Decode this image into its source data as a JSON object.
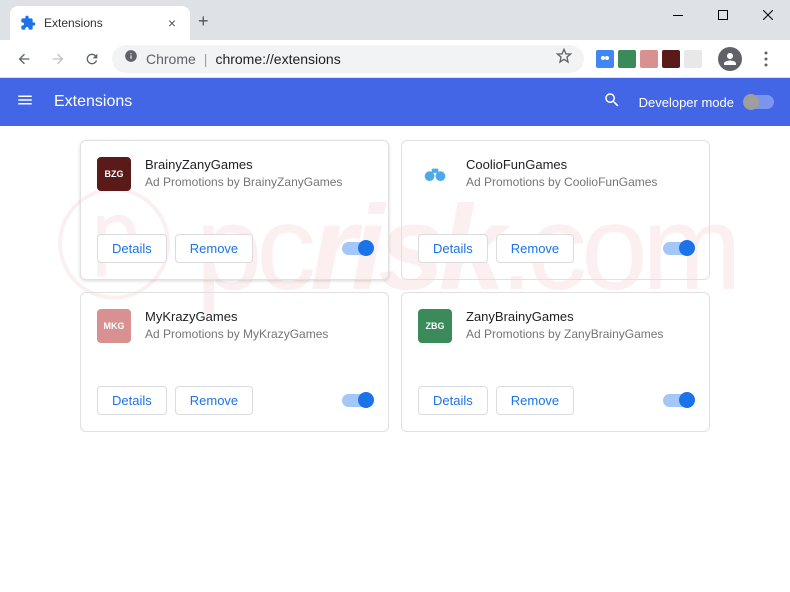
{
  "window": {
    "tab_title": "Extensions"
  },
  "address": {
    "prefix": "Chrome",
    "url": "chrome://extensions"
  },
  "header": {
    "title": "Extensions",
    "developer_mode": "Developer mode"
  },
  "buttons": {
    "details": "Details",
    "remove": "Remove"
  },
  "extensions": [
    {
      "name": "BrainyZanyGames",
      "description": "Ad Promotions by BrainyZanyGames",
      "logo_text": "BZG",
      "logo_bg": "#5a1a1a",
      "selected": true
    },
    {
      "name": "CoolioFunGames",
      "description": "Ad Promotions by CoolioFunGames",
      "logo_text": "",
      "logo_bg": "#ffffff",
      "icon": "binoculars",
      "selected": false
    },
    {
      "name": "MyKrazyGames",
      "description": "Ad Promotions by MyKrazyGames",
      "logo_text": "MKG",
      "logo_bg": "#d89090",
      "selected": false
    },
    {
      "name": "ZanyBrainyGames",
      "description": "Ad Promotions by ZanyBrainyGames",
      "logo_text": "ZBG",
      "logo_bg": "#3a8a5a",
      "selected": false
    }
  ],
  "toolbar_ext_icons": [
    {
      "bg": "#4285f4",
      "text": ""
    },
    {
      "bg": "#3a8a5a",
      "text": ""
    },
    {
      "bg": "#d89090",
      "text": ""
    },
    {
      "bg": "#5a1a1a",
      "text": ""
    },
    {
      "bg": "#e8e8e8",
      "text": ""
    }
  ]
}
